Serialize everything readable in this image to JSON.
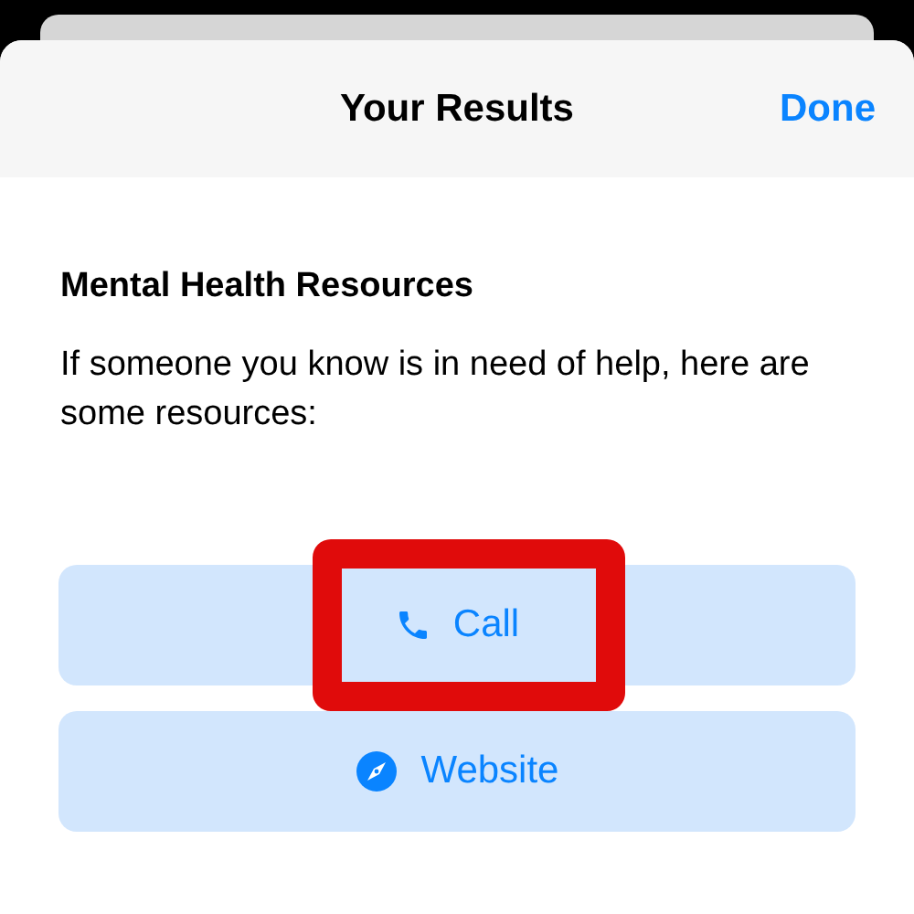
{
  "header": {
    "title": "Your Results",
    "done": "Done"
  },
  "section": {
    "heading": "Mental Health Resources",
    "text": "If someone you know is in need of help, here are some resources:"
  },
  "actions": [
    {
      "kind": "call",
      "label": "Call",
      "highlighted": true
    },
    {
      "kind": "website",
      "label": "Website",
      "highlighted": false
    }
  ]
}
